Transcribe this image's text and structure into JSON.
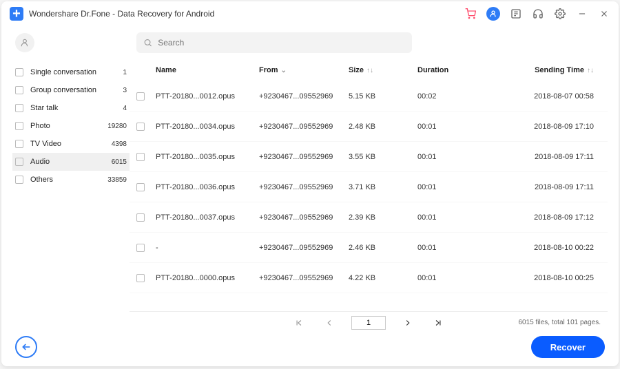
{
  "title": "Wondershare Dr.Fone - Data Recovery for Android",
  "search": {
    "placeholder": "Search"
  },
  "sidebar": {
    "items": [
      {
        "label": "Single conversation",
        "count": "1",
        "selected": false
      },
      {
        "label": "Group conversation",
        "count": "3",
        "selected": false
      },
      {
        "label": "Star talk",
        "count": "4",
        "selected": false
      },
      {
        "label": "Photo",
        "count": "19280",
        "selected": false
      },
      {
        "label": "TV Video",
        "count": "4398",
        "selected": false
      },
      {
        "label": "Audio",
        "count": "6015",
        "selected": true
      },
      {
        "label": "Others",
        "count": "33859",
        "selected": false
      }
    ]
  },
  "columns": {
    "name": "Name",
    "from": "From",
    "size": "Size",
    "duration": "Duration",
    "time": "Sending Time"
  },
  "rows": [
    {
      "name": "PTT-20180...0012.opus",
      "from": "+9230467...09552969",
      "size": "5.15 KB",
      "duration": "00:02",
      "time": "2018-08-07 00:58"
    },
    {
      "name": "PTT-20180...0034.opus",
      "from": "+9230467...09552969",
      "size": "2.48 KB",
      "duration": "00:01",
      "time": "2018-08-09 17:10"
    },
    {
      "name": "PTT-20180...0035.opus",
      "from": "+9230467...09552969",
      "size": "3.55 KB",
      "duration": "00:01",
      "time": "2018-08-09 17:11"
    },
    {
      "name": "PTT-20180...0036.opus",
      "from": "+9230467...09552969",
      "size": "3.71 KB",
      "duration": "00:01",
      "time": "2018-08-09 17:11"
    },
    {
      "name": "PTT-20180...0037.opus",
      "from": "+9230467...09552969",
      "size": "2.39 KB",
      "duration": "00:01",
      "time": "2018-08-09 17:12"
    },
    {
      "name": "-",
      "from": "+9230467...09552969",
      "size": "2.46 KB",
      "duration": "00:01",
      "time": "2018-08-10 00:22"
    },
    {
      "name": "PTT-20180...0000.opus",
      "from": "+9230467...09552969",
      "size": "4.22 KB",
      "duration": "00:01",
      "time": "2018-08-10 00:25"
    }
  ],
  "pager": {
    "page": "1",
    "info": "6015 files, total 101 pages."
  },
  "recover": "Recover"
}
